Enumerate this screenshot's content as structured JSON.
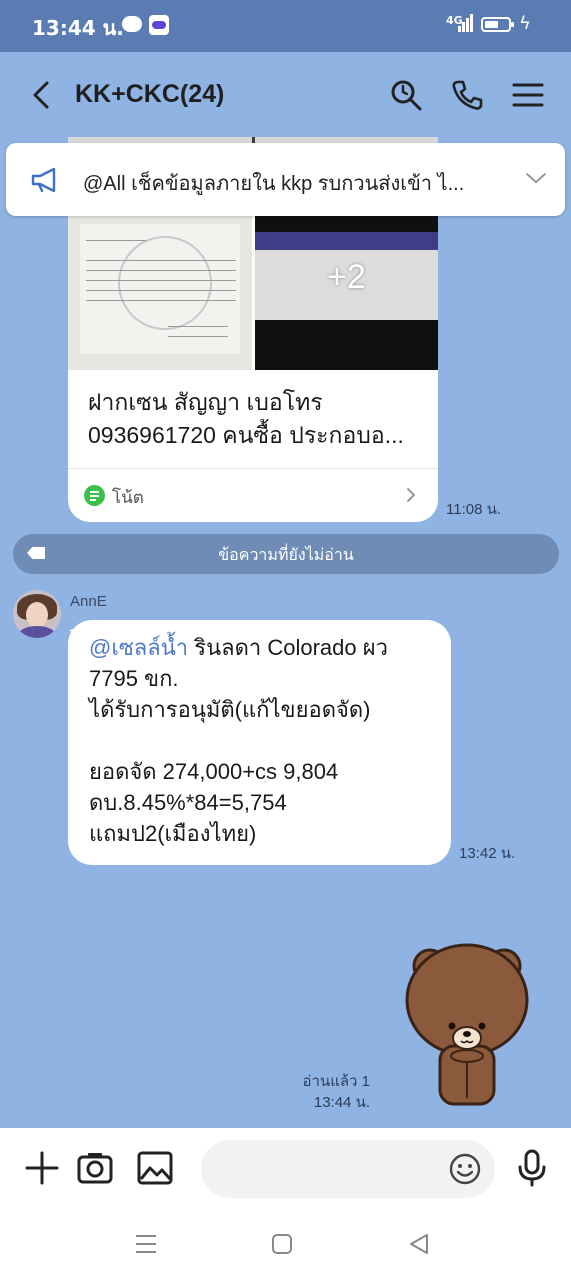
{
  "status_bar": {
    "time": "13:44 น.",
    "network": "4G",
    "battery_percent": 60,
    "icons": [
      "line-app-icon",
      "bot-app-icon",
      "signal-icon",
      "battery-icon",
      "charging-icon"
    ]
  },
  "header": {
    "title": "KK+CKC(24)",
    "icons": [
      "back-arrow-icon",
      "search-icon",
      "phone-icon",
      "menu-icon"
    ]
  },
  "announcement": {
    "text": "@All  เช็คข้อมูลภายใน kkp รบกวนส่งเข้า ไ...",
    "icons": [
      "megaphone-icon",
      "chevron-down-icon"
    ]
  },
  "note_message": {
    "more_photos": "+2",
    "line1": "ฝากเซน สัญญา เบอโทร",
    "line2": "0936961720  คนซื้อ ประกอบอ...",
    "label": "โน้ต",
    "time": "11:08 น."
  },
  "unread_divider": {
    "text": "ข้อความที่ยังไม่อ่าน"
  },
  "text_message": {
    "sender": "AnnE",
    "mention": "@เซลล์น้ำ",
    "line1_rest": " รินลดา Colorado ผว",
    "line2": "7795 ขก.",
    "line3": "ได้รับการอนุมัติ(แก้ไขยอดจัด)",
    "line4": "ยอดจัด 274,000+cs 9,804",
    "line5": "ดบ.8.45%*84=5,754",
    "line6": "แถมป2(เมืองไทย)",
    "time": "13:42 น."
  },
  "sticker_message": {
    "sticker": "brown-bear-sticker",
    "read_status": "อ่านแล้ว 1",
    "time": "13:44 น."
  },
  "input_bar": {
    "placeholder": "",
    "icons": [
      "plus-icon",
      "camera-icon",
      "image-icon",
      "emoji-icon",
      "microphone-icon"
    ]
  },
  "nav_bar": {
    "icons": [
      "recent-apps-icon",
      "home-icon",
      "back-nav-icon"
    ]
  },
  "colors": {
    "chat_background": "#8fb3e2",
    "status_bar": "#5b7cb3",
    "mention": "#4f78c9",
    "unread_bar": "#6f8cb6",
    "note_icon": "#3ac04b"
  }
}
